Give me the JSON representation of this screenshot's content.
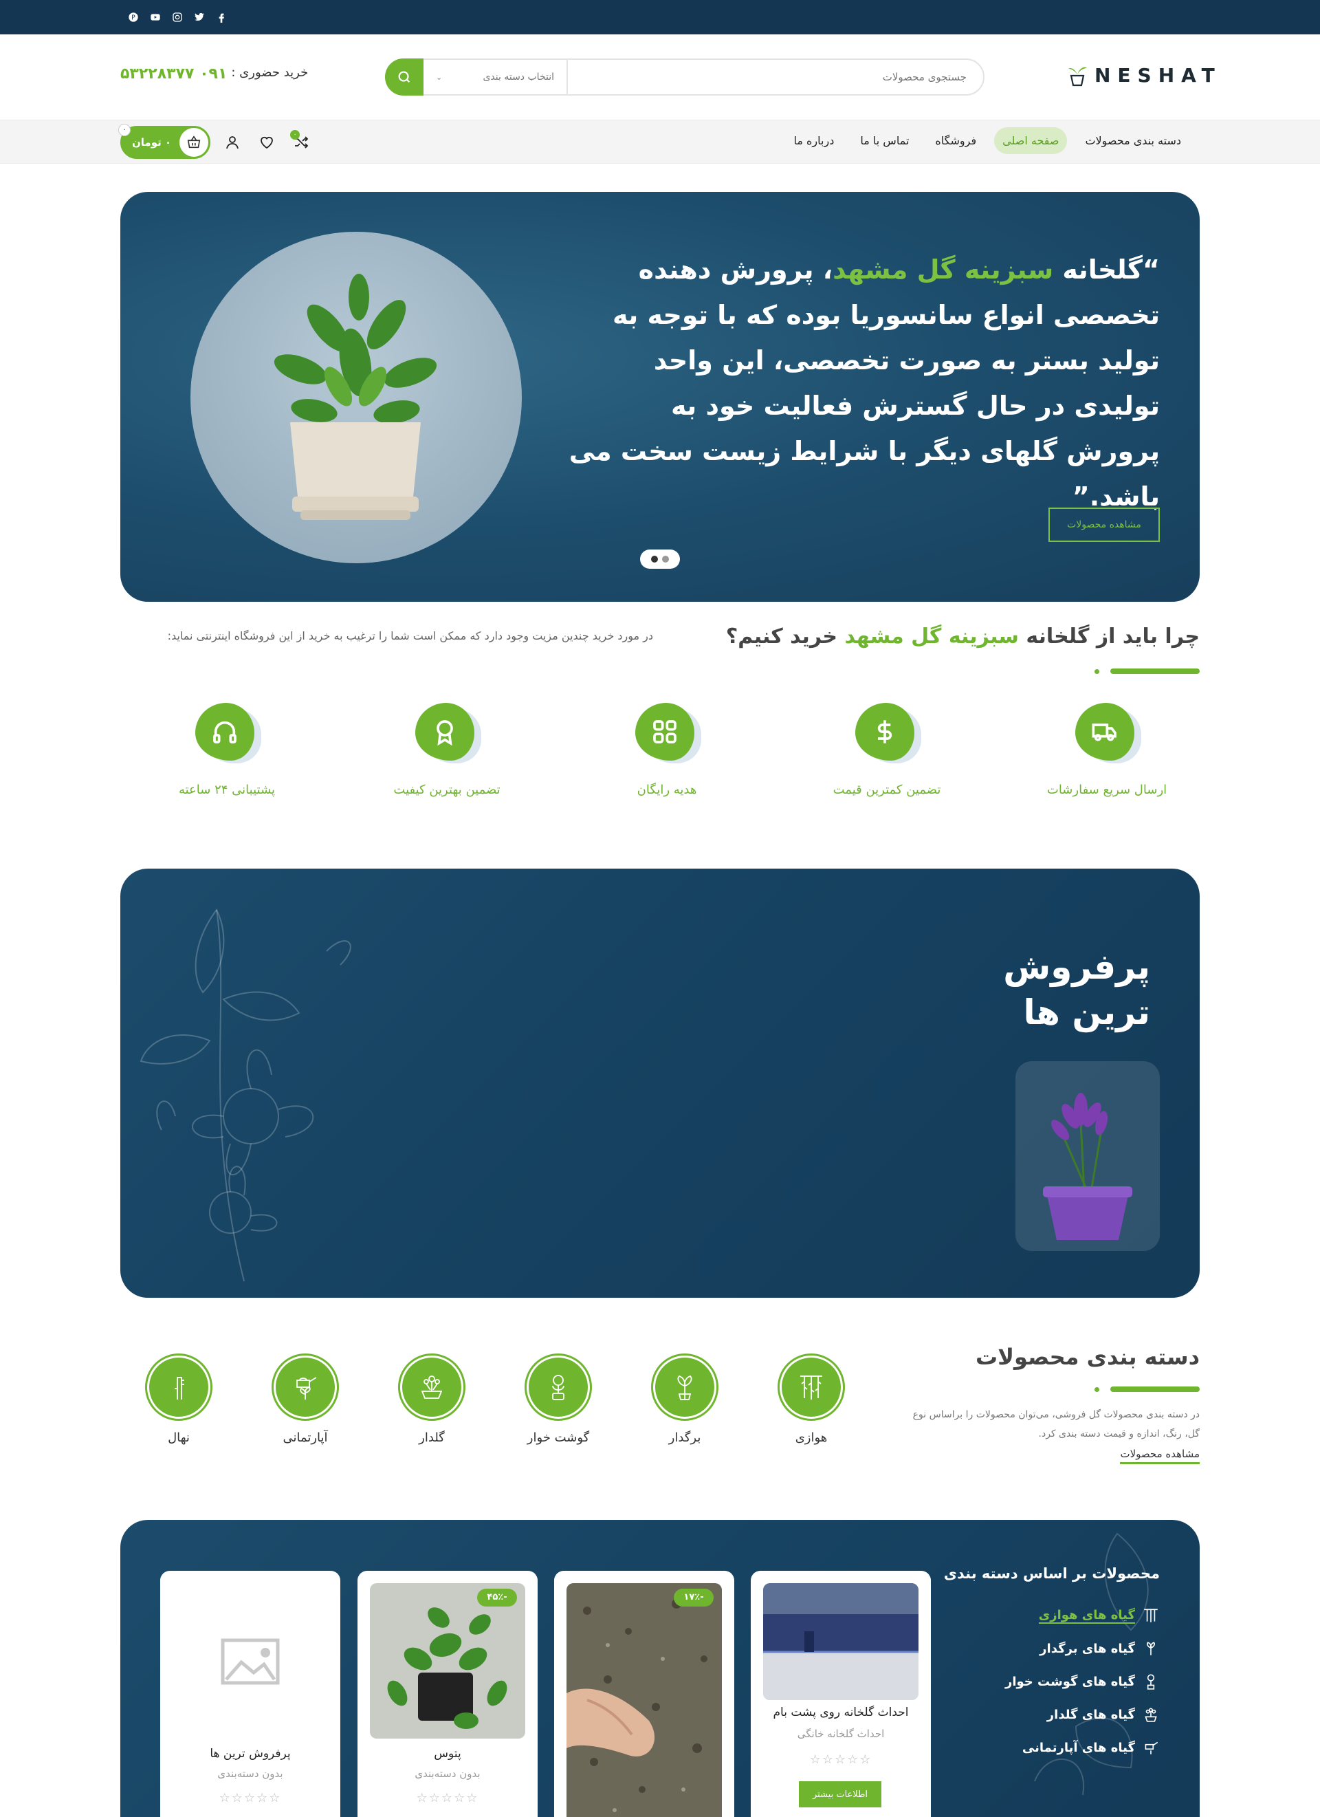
{
  "colors": {
    "brand_green": "#6fb52e",
    "navy": "#143652",
    "hero_bg": "#1d4d6c"
  },
  "topbar": {
    "socials": [
      {
        "icon": "facebook-icon"
      },
      {
        "icon": "twitter-icon"
      },
      {
        "icon": "instagram-icon"
      },
      {
        "icon": "youtube-icon"
      },
      {
        "icon": "pinterest-icon"
      }
    ]
  },
  "header": {
    "logo_text": "NESHAT",
    "search_placeholder": "جستجوی محصولات",
    "category_select": "انتخاب دسته بندی",
    "phone_label": "خرید حضوری :",
    "phone_number": "۰۹۱ ۵۳۲۲۸۳۷۷"
  },
  "nav": {
    "items": [
      {
        "label": "دسته بندی محصولات"
      },
      {
        "label": "صفحه اصلی"
      },
      {
        "label": "فروشگاه"
      },
      {
        "label": "تماس با ما"
      },
      {
        "label": "درباره ما"
      }
    ],
    "cart_total": "۰ تومان",
    "cart_count": "۰",
    "compare_count": "۰"
  },
  "hero": {
    "quote_open": "“گلخانه ",
    "highlight": "سبزینه گل مشهد",
    "quote_rest": "، پرورش دهنده تخصصی انواع سانسوریا بوده که با توجه به تولید بستر به صورت تخصصی، این واحد تولیدی در حال گسترش فعالیت خود به پرورش گلهای دیگر با شرایط زیست سخت می باشد.”",
    "button": "مشاهده محصولات"
  },
  "why": {
    "title_a": "چرا باید از گلخانه ",
    "title_hl": "سبزینه گل مشهد",
    "title_b": " خرید کنیم؟",
    "desc": "در مورد خرید چندین مزیت وجود دارد که ممکن است شما را ترغیب به خرید از این فروشگاه اینترنتی نماید:",
    "features": [
      {
        "label": "ارسال سریع سفارشات",
        "icon": "truck-icon"
      },
      {
        "label": "تضمین کمترین قیمت",
        "icon": "dollar-icon"
      },
      {
        "label": "هدیه رایگان",
        "icon": "grid-icon"
      },
      {
        "label": "تضمین بهترین کیفیت",
        "icon": "award-icon"
      },
      {
        "label": "پشتیبانی ۲۴ ساعته",
        "icon": "headphones-icon"
      }
    ]
  },
  "bestsellers": {
    "title_line1": "پرفروش",
    "title_line2": "ترین ها"
  },
  "categories": {
    "title": "دسته بندی محصولات",
    "desc": "در دسته بندی محصولات گل فروشی، می‌توان محصولات را براساس نوع گل، رنگ، اندازه و قیمت دسته بندی کرد.",
    "link": "مشاهده محصولات",
    "items": [
      {
        "label": "هوازی",
        "icon": "hanging-plant-icon"
      },
      {
        "label": "برگدار",
        "icon": "leaf-plant-icon"
      },
      {
        "label": "گوشت خوار",
        "icon": "carnivorous-plant-icon"
      },
      {
        "label": "گلدار",
        "icon": "flower-pot-icon"
      },
      {
        "label": "آپارتمانی",
        "icon": "watering-can-icon"
      },
      {
        "label": "نهال",
        "icon": "sapling-icon"
      }
    ]
  },
  "products": {
    "side_title": "محصولات بر اساس دسته بندی",
    "side_items": [
      {
        "label": "گیاه های هوازی",
        "icon": "hanging-plant-icon"
      },
      {
        "label": "گیاه های برگدار",
        "icon": "leaf-plant-icon"
      },
      {
        "label": "گیاه های گوشت خوار",
        "icon": "carnivorous-plant-icon"
      },
      {
        "label": "گیاه های گلدار",
        "icon": "flower-pot-icon"
      },
      {
        "label": "گیاه های آپارتمانی",
        "icon": "watering-can-icon"
      }
    ],
    "cards": [
      {
        "name": "احداث گلخانه روی پشت بام",
        "category": "احداث گلخانه خانگی",
        "stars": "☆☆☆☆☆",
        "button": "اطلاعات بیشتر"
      },
      {
        "badge": "-۱۷٪"
      },
      {
        "name": "پتوس",
        "category": "بدون دسته‌بندی",
        "stars": "☆☆☆☆☆",
        "badge": "-۴۵٪"
      },
      {
        "name": "پرفروش ترین ها",
        "category": "بدون دسته‌بندی",
        "stars": "☆☆☆☆☆"
      }
    ]
  }
}
